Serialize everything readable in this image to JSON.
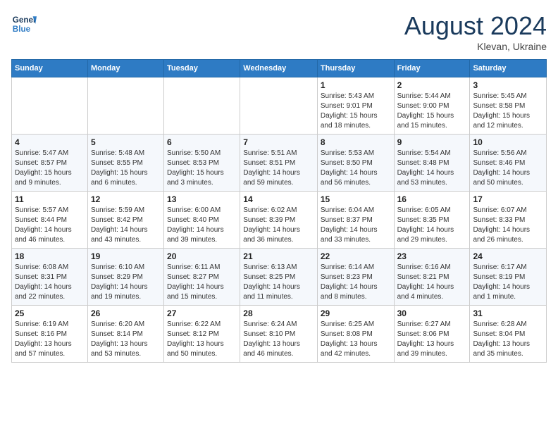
{
  "header": {
    "logo_line1": "General",
    "logo_line2": "Blue",
    "month": "August 2024",
    "location": "Klevan, Ukraine"
  },
  "days_of_week": [
    "Sunday",
    "Monday",
    "Tuesday",
    "Wednesday",
    "Thursday",
    "Friday",
    "Saturday"
  ],
  "weeks": [
    [
      {
        "day": "",
        "info": ""
      },
      {
        "day": "",
        "info": ""
      },
      {
        "day": "",
        "info": ""
      },
      {
        "day": "",
        "info": ""
      },
      {
        "day": "1",
        "info": "Sunrise: 5:43 AM\nSunset: 9:01 PM\nDaylight: 15 hours\nand 18 minutes."
      },
      {
        "day": "2",
        "info": "Sunrise: 5:44 AM\nSunset: 9:00 PM\nDaylight: 15 hours\nand 15 minutes."
      },
      {
        "day": "3",
        "info": "Sunrise: 5:45 AM\nSunset: 8:58 PM\nDaylight: 15 hours\nand 12 minutes."
      }
    ],
    [
      {
        "day": "4",
        "info": "Sunrise: 5:47 AM\nSunset: 8:57 PM\nDaylight: 15 hours\nand 9 minutes."
      },
      {
        "day": "5",
        "info": "Sunrise: 5:48 AM\nSunset: 8:55 PM\nDaylight: 15 hours\nand 6 minutes."
      },
      {
        "day": "6",
        "info": "Sunrise: 5:50 AM\nSunset: 8:53 PM\nDaylight: 15 hours\nand 3 minutes."
      },
      {
        "day": "7",
        "info": "Sunrise: 5:51 AM\nSunset: 8:51 PM\nDaylight: 14 hours\nand 59 minutes."
      },
      {
        "day": "8",
        "info": "Sunrise: 5:53 AM\nSunset: 8:50 PM\nDaylight: 14 hours\nand 56 minutes."
      },
      {
        "day": "9",
        "info": "Sunrise: 5:54 AM\nSunset: 8:48 PM\nDaylight: 14 hours\nand 53 minutes."
      },
      {
        "day": "10",
        "info": "Sunrise: 5:56 AM\nSunset: 8:46 PM\nDaylight: 14 hours\nand 50 minutes."
      }
    ],
    [
      {
        "day": "11",
        "info": "Sunrise: 5:57 AM\nSunset: 8:44 PM\nDaylight: 14 hours\nand 46 minutes."
      },
      {
        "day": "12",
        "info": "Sunrise: 5:59 AM\nSunset: 8:42 PM\nDaylight: 14 hours\nand 43 minutes."
      },
      {
        "day": "13",
        "info": "Sunrise: 6:00 AM\nSunset: 8:40 PM\nDaylight: 14 hours\nand 39 minutes."
      },
      {
        "day": "14",
        "info": "Sunrise: 6:02 AM\nSunset: 8:39 PM\nDaylight: 14 hours\nand 36 minutes."
      },
      {
        "day": "15",
        "info": "Sunrise: 6:04 AM\nSunset: 8:37 PM\nDaylight: 14 hours\nand 33 minutes."
      },
      {
        "day": "16",
        "info": "Sunrise: 6:05 AM\nSunset: 8:35 PM\nDaylight: 14 hours\nand 29 minutes."
      },
      {
        "day": "17",
        "info": "Sunrise: 6:07 AM\nSunset: 8:33 PM\nDaylight: 14 hours\nand 26 minutes."
      }
    ],
    [
      {
        "day": "18",
        "info": "Sunrise: 6:08 AM\nSunset: 8:31 PM\nDaylight: 14 hours\nand 22 minutes."
      },
      {
        "day": "19",
        "info": "Sunrise: 6:10 AM\nSunset: 8:29 PM\nDaylight: 14 hours\nand 19 minutes."
      },
      {
        "day": "20",
        "info": "Sunrise: 6:11 AM\nSunset: 8:27 PM\nDaylight: 14 hours\nand 15 minutes."
      },
      {
        "day": "21",
        "info": "Sunrise: 6:13 AM\nSunset: 8:25 PM\nDaylight: 14 hours\nand 11 minutes."
      },
      {
        "day": "22",
        "info": "Sunrise: 6:14 AM\nSunset: 8:23 PM\nDaylight: 14 hours\nand 8 minutes."
      },
      {
        "day": "23",
        "info": "Sunrise: 6:16 AM\nSunset: 8:21 PM\nDaylight: 14 hours\nand 4 minutes."
      },
      {
        "day": "24",
        "info": "Sunrise: 6:17 AM\nSunset: 8:19 PM\nDaylight: 14 hours\nand 1 minute."
      }
    ],
    [
      {
        "day": "25",
        "info": "Sunrise: 6:19 AM\nSunset: 8:16 PM\nDaylight: 13 hours\nand 57 minutes."
      },
      {
        "day": "26",
        "info": "Sunrise: 6:20 AM\nSunset: 8:14 PM\nDaylight: 13 hours\nand 53 minutes."
      },
      {
        "day": "27",
        "info": "Sunrise: 6:22 AM\nSunset: 8:12 PM\nDaylight: 13 hours\nand 50 minutes."
      },
      {
        "day": "28",
        "info": "Sunrise: 6:24 AM\nSunset: 8:10 PM\nDaylight: 13 hours\nand 46 minutes."
      },
      {
        "day": "29",
        "info": "Sunrise: 6:25 AM\nSunset: 8:08 PM\nDaylight: 13 hours\nand 42 minutes."
      },
      {
        "day": "30",
        "info": "Sunrise: 6:27 AM\nSunset: 8:06 PM\nDaylight: 13 hours\nand 39 minutes."
      },
      {
        "day": "31",
        "info": "Sunrise: 6:28 AM\nSunset: 8:04 PM\nDaylight: 13 hours\nand 35 minutes."
      }
    ]
  ]
}
